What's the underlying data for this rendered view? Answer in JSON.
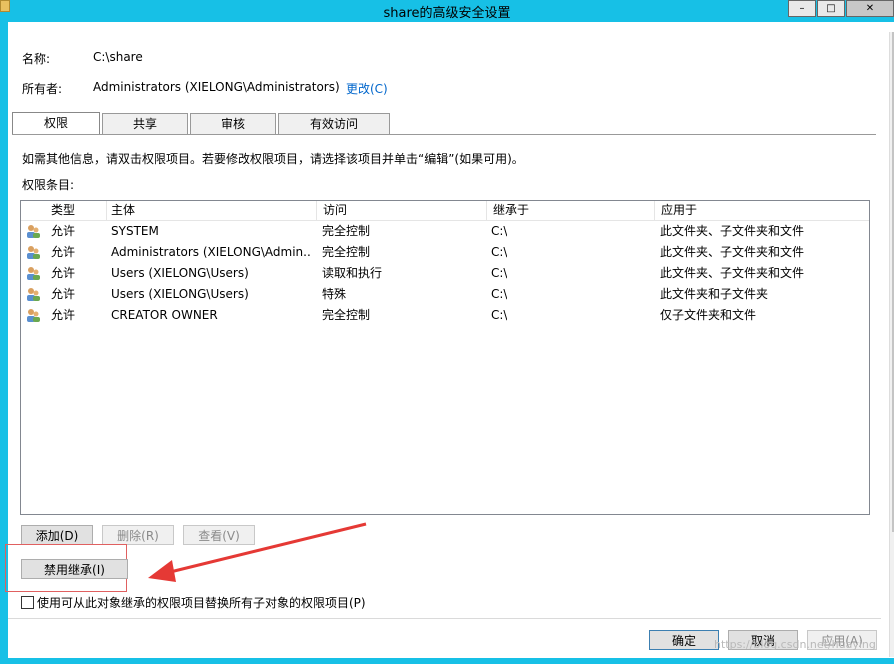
{
  "window": {
    "title": "share的高级安全设置"
  },
  "info": {
    "name_label": "名称:",
    "name_value": "C:\\share",
    "owner_label": "所有者:",
    "owner_value": "Administrators (XIELONG\\Administrators)",
    "change_link": "更改(C)"
  },
  "tabs": [
    {
      "label": "权限"
    },
    {
      "label": "共享"
    },
    {
      "label": "审核"
    },
    {
      "label": "有效访问"
    }
  ],
  "instructions": "如需其他信息，请双击权限项目。若要修改权限项目，请选择该项目并单击“编辑”(如果可用)。",
  "list_label": "权限条目:",
  "columns": [
    "类型",
    "主体",
    "访问",
    "继承于",
    "应用于"
  ],
  "rows": [
    {
      "type": "允许",
      "principal": "SYSTEM",
      "access": "完全控制",
      "inherited": "C:\\",
      "applies": "此文件夹、子文件夹和文件"
    },
    {
      "type": "允许",
      "principal": "Administrators (XIELONG\\Admin...",
      "access": "完全控制",
      "inherited": "C:\\",
      "applies": "此文件夹、子文件夹和文件"
    },
    {
      "type": "允许",
      "principal": "Users (XIELONG\\Users)",
      "access": "读取和执行",
      "inherited": "C:\\",
      "applies": "此文件夹、子文件夹和文件"
    },
    {
      "type": "允许",
      "principal": "Users (XIELONG\\Users)",
      "access": "特殊",
      "inherited": "C:\\",
      "applies": "此文件夹和子文件夹"
    },
    {
      "type": "允许",
      "principal": "CREATOR OWNER",
      "access": "完全控制",
      "inherited": "C:\\",
      "applies": "仅子文件夹和文件"
    }
  ],
  "buttons": {
    "add": "添加(D)",
    "remove": "删除(R)",
    "view": "查看(V)",
    "disable_inheritance": "禁用继承(I)",
    "ok": "确定",
    "cancel": "取消",
    "apply": "应用(A)"
  },
  "replace_checkbox_label": "使用可从此对象继承的权限项目替换所有子对象的权限项目(P)",
  "watermark": "https://blog.csdn.net/huaying"
}
